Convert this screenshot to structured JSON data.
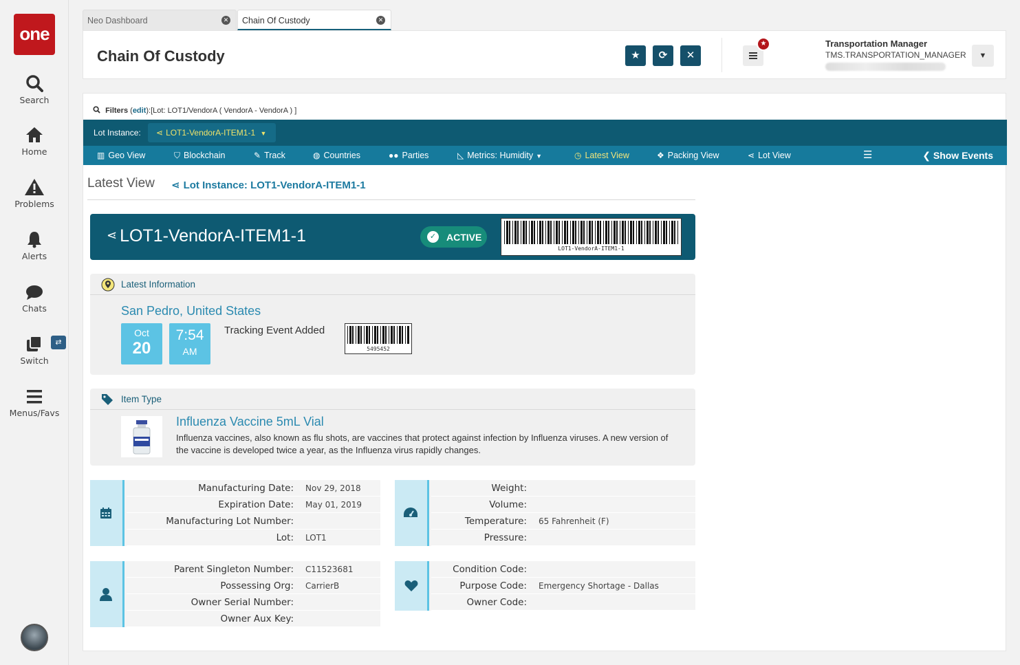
{
  "nav": {
    "logo": "one",
    "items": [
      {
        "label": "Search",
        "icon": "search-icon"
      },
      {
        "label": "Home",
        "icon": "home-icon"
      },
      {
        "label": "Problems",
        "icon": "warning-icon"
      },
      {
        "label": "Alerts",
        "icon": "bell-icon"
      },
      {
        "label": "Chats",
        "icon": "chat-icon"
      },
      {
        "label": "Switch",
        "icon": "switch-icon"
      },
      {
        "label": "Menus/Favs",
        "icon": "menu-icon"
      }
    ]
  },
  "tabs": [
    {
      "label": "Neo Dashboard",
      "active": false
    },
    {
      "label": "Chain Of Custody",
      "active": true
    }
  ],
  "header": {
    "title": "Chain Of Custody",
    "user_name": "Transportation Manager",
    "user_role": "TMS.TRANSPORTATION_MANAGER"
  },
  "filters": {
    "label": "Filters",
    "edit": "edit",
    "value": ":[Lot: LOT1/VendorA ( VendorA - VendorA ) ]"
  },
  "lotbar": {
    "label": "Lot Instance:",
    "selected": "LOT1-VendorA-ITEM1-1"
  },
  "viewnav": [
    {
      "label": "Geo View",
      "icon": "map-icon"
    },
    {
      "label": "Blockchain",
      "icon": "shield-icon"
    },
    {
      "label": "Track",
      "icon": "pin-icon"
    },
    {
      "label": "Countries",
      "icon": "globe-icon"
    },
    {
      "label": "Parties",
      "icon": "users-icon"
    },
    {
      "label": "Metrics: Humidity",
      "icon": "chart-icon"
    },
    {
      "label": "Latest View",
      "icon": "clock-icon"
    },
    {
      "label": "Packing View",
      "icon": "dropbox-icon"
    },
    {
      "label": "Lot View",
      "icon": "share-icon"
    }
  ],
  "show_events": "Show Events",
  "view": {
    "title": "Latest View",
    "subtitle": "Lot Instance: LOT1-VendorA-ITEM1-1"
  },
  "banner": {
    "title": "LOT1-VendorA-ITEM1-1",
    "status": "ACTIVE",
    "barcode_text": "LOT1-VendorA-ITEM1-1"
  },
  "latest": {
    "heading": "Latest Information",
    "location": "San Pedro, United States",
    "month": "Oct",
    "day": "20",
    "time": "7:54",
    "ampm": "AM",
    "event": "Tracking Event Added",
    "barcode_text": "5495452"
  },
  "item": {
    "heading": "Item Type",
    "name": "Influenza Vaccine 5mL Vial",
    "description": "Influenza vaccines, also known as flu shots, are vaccines that protect against infection by Influenza viruses. A new version of the vaccine is developed twice a year, as the Influenza virus rapidly changes."
  },
  "details": {
    "dates": [
      {
        "k": "Manufacturing Date:",
        "v": "Nov 29, 2018"
      },
      {
        "k": "Expiration Date:",
        "v": "May 01, 2019"
      },
      {
        "k": "Manufacturing Lot Number:",
        "v": ""
      },
      {
        "k": "Lot:",
        "v": "LOT1"
      }
    ],
    "metrics": [
      {
        "k": "Weight:",
        "v": ""
      },
      {
        "k": "Volume:",
        "v": ""
      },
      {
        "k": "Temperature:",
        "v": "65 Fahrenheit (F)"
      },
      {
        "k": "Pressure:",
        "v": ""
      }
    ],
    "owner": [
      {
        "k": "Parent Singleton Number:",
        "v": "C11523681"
      },
      {
        "k": "Possessing Org:",
        "v": "CarrierB"
      },
      {
        "k": "Owner Serial Number:",
        "v": ""
      },
      {
        "k": "Owner Aux Key:",
        "v": ""
      }
    ],
    "codes": [
      {
        "k": "Condition Code:",
        "v": ""
      },
      {
        "k": "Purpose Code:",
        "v": "Emergency Shortage - Dallas"
      },
      {
        "k": "Owner Code:",
        "v": ""
      }
    ]
  },
  "colors": {
    "brand": "#c0181d",
    "primary": "#0e5a72",
    "nav": "#167a9c",
    "accent": "#5cc3e4",
    "active_highlight": "#f3e57a",
    "status_active": "#178c7a"
  }
}
